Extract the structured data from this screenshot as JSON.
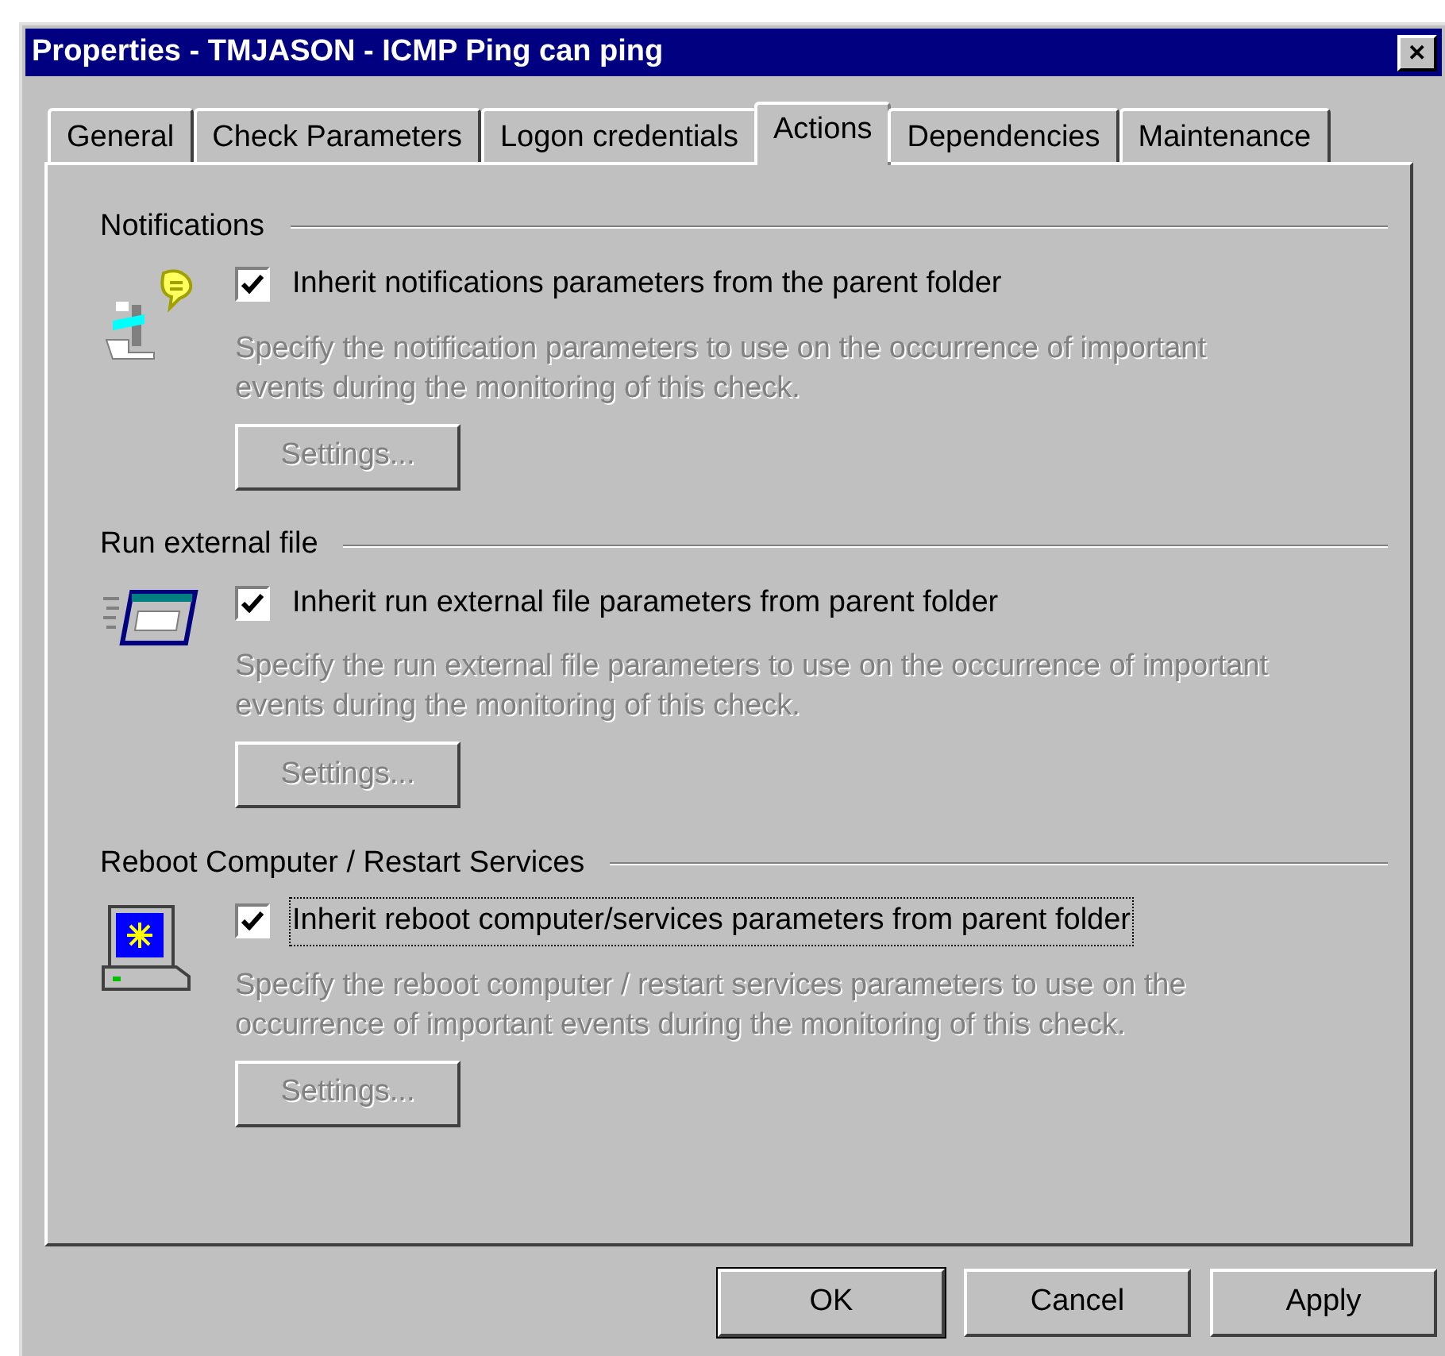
{
  "window": {
    "title": "Properties - TMJASON - ICMP Ping can ping",
    "close": "✕"
  },
  "tabs": [
    {
      "label": "General",
      "selected": false
    },
    {
      "label": "Check Parameters",
      "selected": false
    },
    {
      "label": "Logon credentials",
      "selected": false
    },
    {
      "label": "Actions",
      "selected": true
    },
    {
      "label": "Dependencies",
      "selected": false
    },
    {
      "label": "Maintenance",
      "selected": false
    }
  ],
  "sections": [
    {
      "heading": "Notifications",
      "kind": "notifications",
      "checkbox": {
        "label": "Inherit notifications parameters from the parent folder",
        "checked": true,
        "focused": false
      },
      "description": "Specify the notification parameters to use on the occurrence of important events during the monitoring of this check.",
      "description_disabled": true,
      "button": {
        "label": "Settings...",
        "disabled": true
      }
    },
    {
      "heading": "Run external file",
      "kind": "program",
      "checkbox": {
        "label": "Inherit run external file parameters from parent folder",
        "checked": true,
        "focused": false
      },
      "description": "Specify the run external file parameters to use on the occurrence of important events during the monitoring of this check.",
      "description_disabled": true,
      "button": {
        "label": "Settings...",
        "disabled": true
      }
    },
    {
      "heading": "Reboot Computer / Restart Services",
      "kind": "computer",
      "checkbox": {
        "label": "Inherit reboot computer/services parameters from parent folder",
        "checked": true,
        "focused": true
      },
      "description": "Specify the reboot computer / restart services parameters to use on the occurrence of important events during the monitoring of this check.",
      "description_disabled": true,
      "button": {
        "label": "Settings...",
        "disabled": true
      }
    }
  ],
  "buttons": [
    {
      "label": "OK",
      "default": true
    },
    {
      "label": "Cancel",
      "default": false
    },
    {
      "label": "Apply",
      "default": false
    }
  ]
}
